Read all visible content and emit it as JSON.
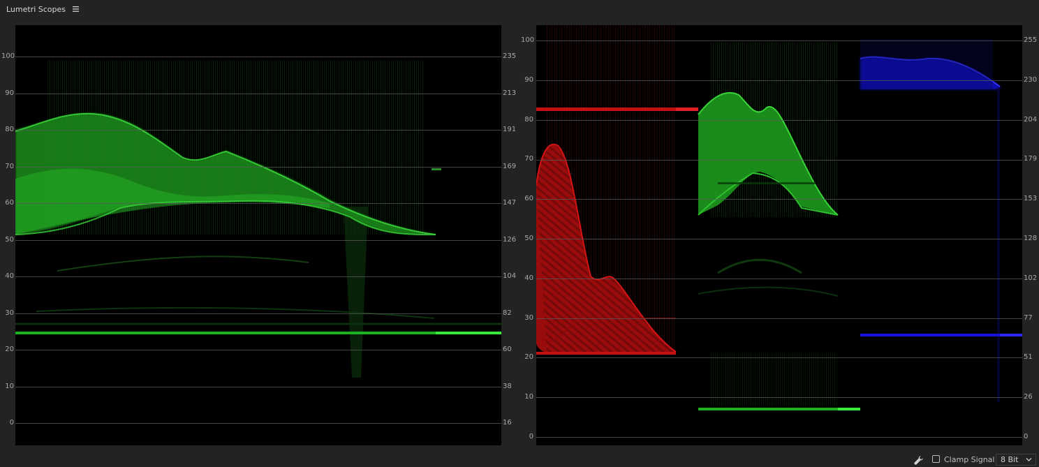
{
  "panel": {
    "title": "Lumetri Scopes",
    "menu_icon": "hamburger-menu-icon"
  },
  "luma_waveform": {
    "left_ticks": [
      "100",
      "90",
      "80",
      "70",
      "60",
      "50",
      "40",
      "30",
      "20",
      "10",
      "0"
    ],
    "right_ticks": [
      "235",
      "213",
      "191",
      "169",
      "147",
      "126",
      "104",
      "82",
      "60",
      "38",
      "16"
    ],
    "trace_color": "#1db51d"
  },
  "rgb_parade": {
    "left_ticks": [
      "100",
      "90",
      "80",
      "70",
      "60",
      "50",
      "40",
      "30",
      "20",
      "10",
      "0"
    ],
    "right_ticks": [
      "255",
      "230",
      "204",
      "179",
      "153",
      "128",
      "102",
      "77",
      "51",
      "26",
      "0"
    ],
    "channel_colors": {
      "red": "#d40e0e",
      "green": "#1fbf1f",
      "blue": "#1212dd"
    }
  },
  "footer": {
    "settings_icon": "wrench-icon",
    "clamp_signal_label": "Clamp Signal",
    "clamp_signal_checked": false,
    "bit_depth_value": "8 Bit"
  }
}
